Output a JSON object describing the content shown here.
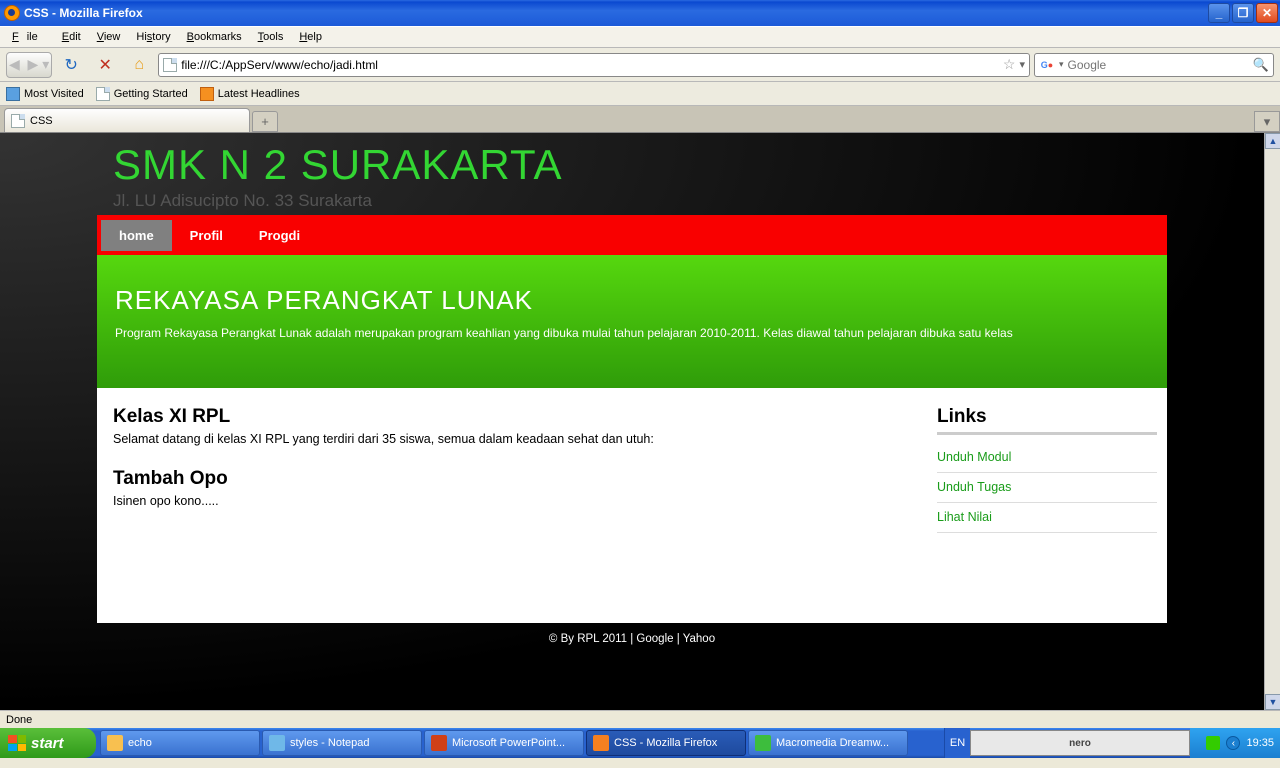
{
  "window": {
    "title": "CSS - Mozilla Firefox"
  },
  "menus": {
    "file": "File",
    "edit": "Edit",
    "view": "View",
    "history": "History",
    "bookmarks": "Bookmarks",
    "tools": "Tools",
    "help": "Help"
  },
  "url": "file:///C:/AppServ/www/echo/jadi.html",
  "search": {
    "placeholder": "Google"
  },
  "bookmarks_bar": [
    "Most Visited",
    "Getting Started",
    "Latest Headlines"
  ],
  "tab": {
    "label": "CSS"
  },
  "site": {
    "title": "SMK N 2 SURAKARTA",
    "subtitle": "Jl. LU Adisucipto No. 33 Surakarta",
    "nav": [
      "home",
      "Profil",
      "Progdi"
    ],
    "banner_title": "REKAYASA PERANGKAT LUNAK",
    "banner_text": "Program Rekayasa Perangkat Lunak adalah merupakan program keahlian yang dibuka mulai tahun pelajaran 2010-2011. Kelas diawal tahun pelajaran dibuka satu kelas",
    "articles": [
      {
        "title": "Kelas XI RPL",
        "body": "Selamat datang di kelas XI RPL yang terdiri dari 35 siswa, semua dalam keadaan sehat dan utuh:"
      },
      {
        "title": "Tambah Opo",
        "body": "Isinen opo kono....."
      }
    ],
    "sidebar_title": "Links",
    "links": [
      "Unduh Modul",
      "Unduh Tugas",
      "Lihat Nilai"
    ],
    "footer": "© By RPL 2011 | Google | Yahoo"
  },
  "status": "Done",
  "taskbar": {
    "start": "start",
    "items": [
      {
        "label": "echo",
        "color": "#f8c050"
      },
      {
        "label": "styles - Notepad",
        "color": "#6fb8e8"
      },
      {
        "label": "Microsoft PowerPoint...",
        "color": "#d04018"
      },
      {
        "label": "CSS - Mozilla Firefox",
        "color": "#f58020",
        "active": true
      },
      {
        "label": "Macromedia Dreamw...",
        "color": "#3dbd3d"
      }
    ],
    "lang": "EN",
    "tray_text": "nero",
    "clock": "19:35"
  }
}
